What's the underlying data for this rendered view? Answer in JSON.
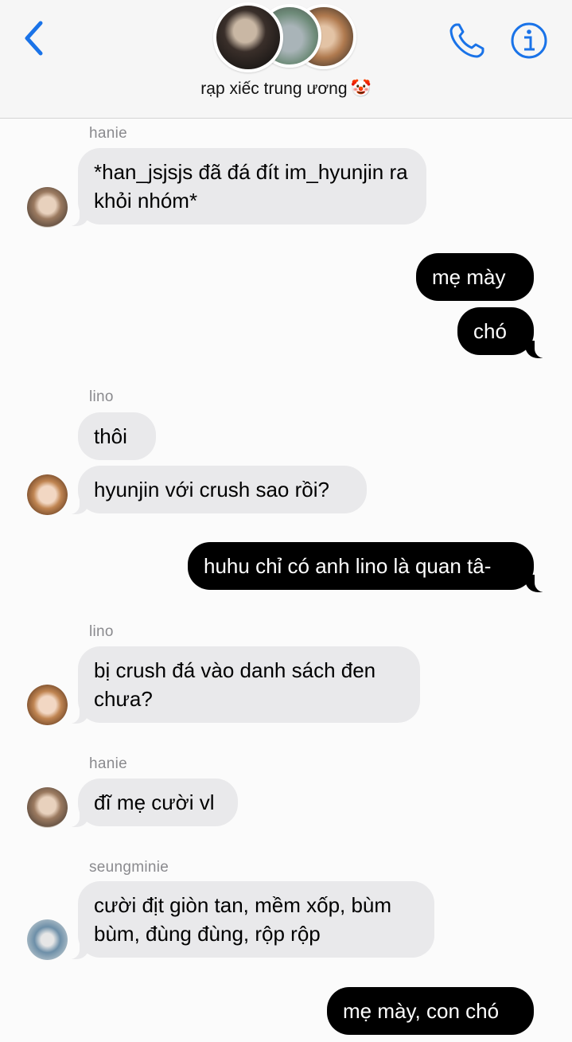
{
  "header": {
    "title": "rạp xiếc trung ương",
    "title_emoji": "🤡",
    "icons": {
      "back": "chevron-left-icon",
      "call": "phone-icon",
      "info": "info-icon"
    },
    "accent_color": "#1a73e8"
  },
  "messages": [
    {
      "sender": "hanie",
      "direction": "in",
      "text": "*han_jsjsjs đã đá đít im_hyunjin ra khỏi nhóm*"
    },
    {
      "sender": "me",
      "direction": "out",
      "text": "mẹ mày"
    },
    {
      "sender": "me",
      "direction": "out",
      "text": "chó"
    },
    {
      "sender": "lino",
      "direction": "in",
      "text": "thôi"
    },
    {
      "sender": "lino",
      "direction": "in",
      "text": "hyunjin với crush sao rồi?"
    },
    {
      "sender": "me",
      "direction": "out",
      "text": "huhu chỉ có anh lino là quan tâ-"
    },
    {
      "sender": "lino",
      "direction": "in",
      "text": "bị crush đá vào danh sách đen chưa?"
    },
    {
      "sender": "hanie",
      "direction": "in",
      "text": "đĩ mẹ cười vl"
    },
    {
      "sender": "seungminie",
      "direction": "in",
      "text": "cười địt giòn tan, mềm xốp, bùm bùm, đùng đùng, rộp rộp"
    },
    {
      "sender": "me",
      "direction": "out",
      "text": "mẹ mày, con chó"
    }
  ],
  "names": [
    "hanie",
    "lino",
    "lino",
    "hanie",
    "seungminie"
  ],
  "colors": {
    "incoming_bubble": "#e9e9eb",
    "outgoing_bubble": "#000000",
    "name_gray": "#8a8a8e"
  }
}
